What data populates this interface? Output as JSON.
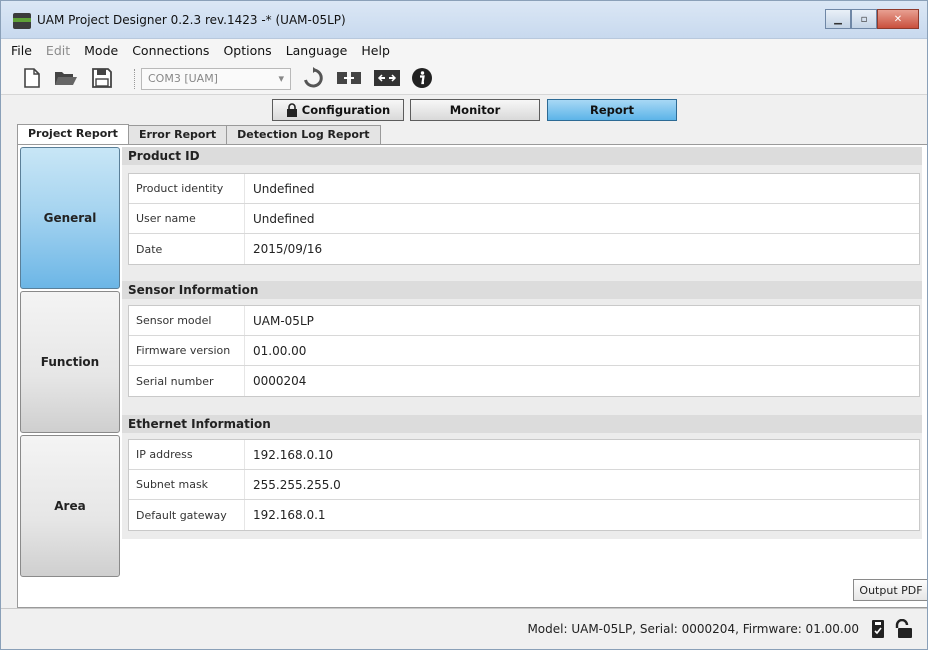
{
  "window": {
    "title": "UAM Project Designer 0.2.3 rev.1423 -* (UAM-05LP)"
  },
  "menu": [
    "File",
    "Edit",
    "Mode",
    "Connections",
    "Options",
    "Language",
    "Help"
  ],
  "toolbar": {
    "port_value": "COM3 [UAM]"
  },
  "modes": {
    "configuration": "Configuration",
    "monitor": "Monitor",
    "report": "Report",
    "active": "Report"
  },
  "tabs": [
    {
      "label": "Project Report",
      "active": true
    },
    {
      "label": "Error Report",
      "active": false
    },
    {
      "label": "Detection Log Report",
      "active": false
    }
  ],
  "sidebar": [
    {
      "label": "General",
      "active": true
    },
    {
      "label": "Function",
      "active": false
    },
    {
      "label": "Area",
      "active": false
    }
  ],
  "sections": {
    "product_id": {
      "title": "Product ID",
      "rows": [
        {
          "label": "Product identity",
          "value": "Undefined"
        },
        {
          "label": "User name",
          "value": "Undefined"
        },
        {
          "label": "Date",
          "value": "2015/09/16"
        }
      ]
    },
    "sensor_info": {
      "title": "Sensor Information",
      "rows": [
        {
          "label": "Sensor model",
          "value": "UAM-05LP"
        },
        {
          "label": "Firmware version",
          "value": "01.00.00"
        },
        {
          "label": "Serial number",
          "value": "0000204"
        }
      ]
    },
    "ethernet_info": {
      "title": "Ethernet Information",
      "rows": [
        {
          "label": "IP address",
          "value": "192.168.0.10"
        },
        {
          "label": "Subnet mask",
          "value": "255.255.255.0"
        },
        {
          "label": "Default gateway",
          "value": "192.168.0.1"
        }
      ]
    }
  },
  "output_pdf_label": "Output PDF",
  "status": {
    "text": "Model: UAM-05LP, Serial: 0000204, Firmware: 01.00.00"
  },
  "colors": {
    "active_blue": "#6cb6e6",
    "title_bar": "#c8d9ee",
    "close_red": "#c9503d"
  }
}
